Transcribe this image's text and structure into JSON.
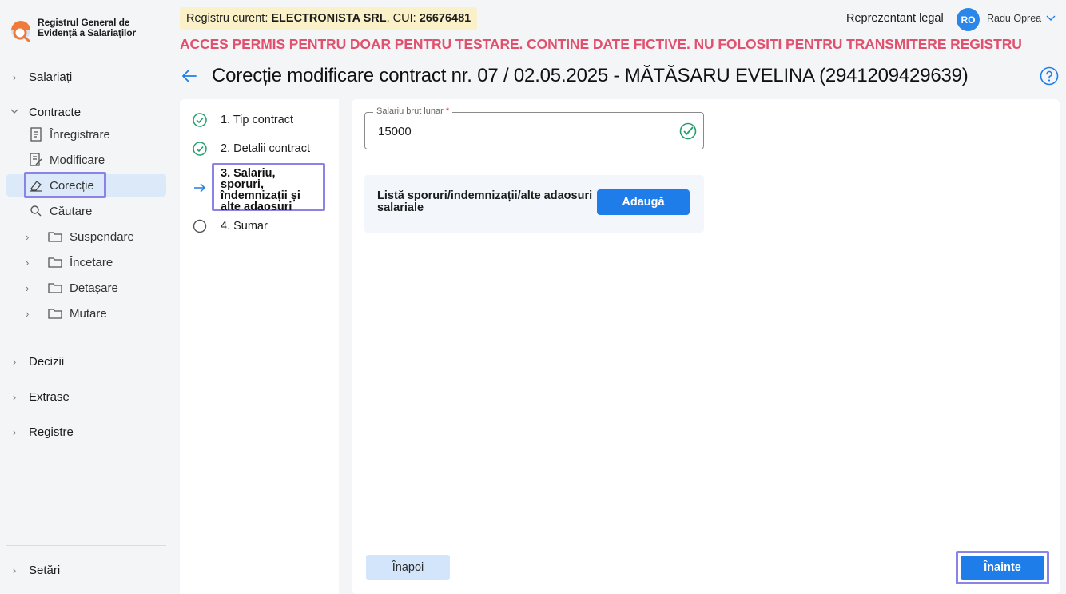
{
  "app": {
    "logo_line1": "Registrul General de",
    "logo_line2": "Evidență a Salariaților"
  },
  "sidebar": {
    "salariati": "Salariați",
    "contracte": "Contracte",
    "contracte_items": [
      "Înregistrare",
      "Modificare",
      "Corecție",
      "Căutare"
    ],
    "folders": [
      "Suspendare",
      "Încetare",
      "Detașare",
      "Mutare"
    ],
    "decizii": "Decizii",
    "extrase": "Extrase",
    "registre": "Registre",
    "setari": "Setări"
  },
  "header": {
    "registry_prefix": "Registru curent: ",
    "company": "ELECTRONISTA SRL",
    "cui_prefix": ", CUI: ",
    "cui": "26676481",
    "role": "Reprezentant legal",
    "avatar_initials": "RO",
    "username": "Radu Oprea",
    "warning": "ACCES PERMIS PENTRU DOAR PENTRU TESTARE. CONTINE DATE FICTIVE. NU FOLOSITI PENTRU TRANSMITERE REGISTRU"
  },
  "page": {
    "title": "Corecție modificare contract nr. 07 / 02.05.2025 - MĂTĂSARU  EVELINA (2941209429639)"
  },
  "stepper": {
    "step1": "1. Tip contract",
    "step2": "2. Detalii contract",
    "step3": "3. Salariu, sporuri, îndemnizații și alte adaosuri",
    "step4": "4. Sumar"
  },
  "form": {
    "salary_label": "Salariu brut lunar",
    "salary_required": "*",
    "salary_value": "15000",
    "adaos_label": "Listă sporuri/indemnizații/alte adaosuri salariale",
    "add_button": "Adaugă",
    "back_button": "Înapoi",
    "next_button": "Înainte"
  },
  "colors": {
    "accent": "#1e7de9",
    "warning": "#e1516e",
    "highlight": "#8a84e6",
    "success": "#22a06b"
  }
}
